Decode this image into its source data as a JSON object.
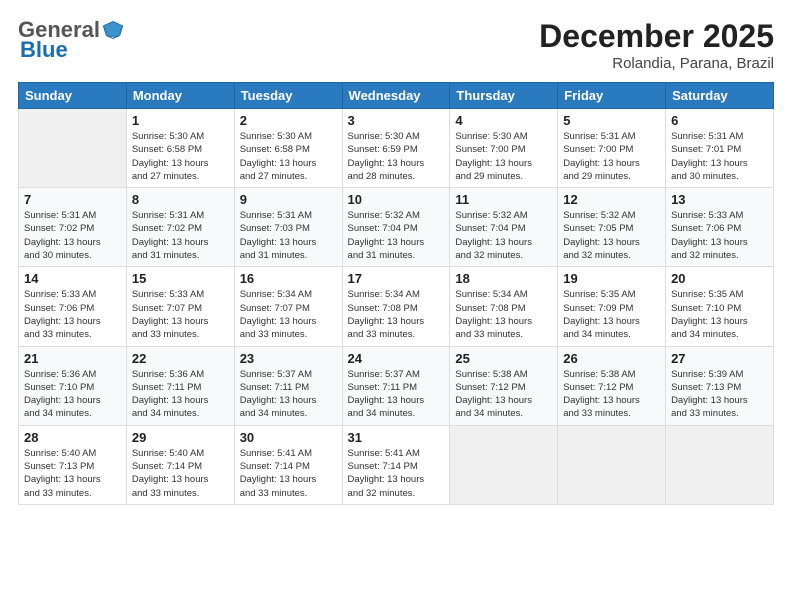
{
  "logo": {
    "general": "General",
    "blue": "Blue"
  },
  "header": {
    "month": "December 2025",
    "location": "Rolandia, Parana, Brazil"
  },
  "weekdays": [
    "Sunday",
    "Monday",
    "Tuesday",
    "Wednesday",
    "Thursday",
    "Friday",
    "Saturday"
  ],
  "weeks": [
    [
      {
        "day": "",
        "info": ""
      },
      {
        "day": "1",
        "info": "Sunrise: 5:30 AM\nSunset: 6:58 PM\nDaylight: 13 hours\nand 27 minutes."
      },
      {
        "day": "2",
        "info": "Sunrise: 5:30 AM\nSunset: 6:58 PM\nDaylight: 13 hours\nand 27 minutes."
      },
      {
        "day": "3",
        "info": "Sunrise: 5:30 AM\nSunset: 6:59 PM\nDaylight: 13 hours\nand 28 minutes."
      },
      {
        "day": "4",
        "info": "Sunrise: 5:30 AM\nSunset: 7:00 PM\nDaylight: 13 hours\nand 29 minutes."
      },
      {
        "day": "5",
        "info": "Sunrise: 5:31 AM\nSunset: 7:00 PM\nDaylight: 13 hours\nand 29 minutes."
      },
      {
        "day": "6",
        "info": "Sunrise: 5:31 AM\nSunset: 7:01 PM\nDaylight: 13 hours\nand 30 minutes."
      }
    ],
    [
      {
        "day": "7",
        "info": "Sunrise: 5:31 AM\nSunset: 7:02 PM\nDaylight: 13 hours\nand 30 minutes."
      },
      {
        "day": "8",
        "info": "Sunrise: 5:31 AM\nSunset: 7:02 PM\nDaylight: 13 hours\nand 31 minutes."
      },
      {
        "day": "9",
        "info": "Sunrise: 5:31 AM\nSunset: 7:03 PM\nDaylight: 13 hours\nand 31 minutes."
      },
      {
        "day": "10",
        "info": "Sunrise: 5:32 AM\nSunset: 7:04 PM\nDaylight: 13 hours\nand 31 minutes."
      },
      {
        "day": "11",
        "info": "Sunrise: 5:32 AM\nSunset: 7:04 PM\nDaylight: 13 hours\nand 32 minutes."
      },
      {
        "day": "12",
        "info": "Sunrise: 5:32 AM\nSunset: 7:05 PM\nDaylight: 13 hours\nand 32 minutes."
      },
      {
        "day": "13",
        "info": "Sunrise: 5:33 AM\nSunset: 7:06 PM\nDaylight: 13 hours\nand 32 minutes."
      }
    ],
    [
      {
        "day": "14",
        "info": "Sunrise: 5:33 AM\nSunset: 7:06 PM\nDaylight: 13 hours\nand 33 minutes."
      },
      {
        "day": "15",
        "info": "Sunrise: 5:33 AM\nSunset: 7:07 PM\nDaylight: 13 hours\nand 33 minutes."
      },
      {
        "day": "16",
        "info": "Sunrise: 5:34 AM\nSunset: 7:07 PM\nDaylight: 13 hours\nand 33 minutes."
      },
      {
        "day": "17",
        "info": "Sunrise: 5:34 AM\nSunset: 7:08 PM\nDaylight: 13 hours\nand 33 minutes."
      },
      {
        "day": "18",
        "info": "Sunrise: 5:34 AM\nSunset: 7:08 PM\nDaylight: 13 hours\nand 33 minutes."
      },
      {
        "day": "19",
        "info": "Sunrise: 5:35 AM\nSunset: 7:09 PM\nDaylight: 13 hours\nand 34 minutes."
      },
      {
        "day": "20",
        "info": "Sunrise: 5:35 AM\nSunset: 7:10 PM\nDaylight: 13 hours\nand 34 minutes."
      }
    ],
    [
      {
        "day": "21",
        "info": "Sunrise: 5:36 AM\nSunset: 7:10 PM\nDaylight: 13 hours\nand 34 minutes."
      },
      {
        "day": "22",
        "info": "Sunrise: 5:36 AM\nSunset: 7:11 PM\nDaylight: 13 hours\nand 34 minutes."
      },
      {
        "day": "23",
        "info": "Sunrise: 5:37 AM\nSunset: 7:11 PM\nDaylight: 13 hours\nand 34 minutes."
      },
      {
        "day": "24",
        "info": "Sunrise: 5:37 AM\nSunset: 7:11 PM\nDaylight: 13 hours\nand 34 minutes."
      },
      {
        "day": "25",
        "info": "Sunrise: 5:38 AM\nSunset: 7:12 PM\nDaylight: 13 hours\nand 34 minutes."
      },
      {
        "day": "26",
        "info": "Sunrise: 5:38 AM\nSunset: 7:12 PM\nDaylight: 13 hours\nand 33 minutes."
      },
      {
        "day": "27",
        "info": "Sunrise: 5:39 AM\nSunset: 7:13 PM\nDaylight: 13 hours\nand 33 minutes."
      }
    ],
    [
      {
        "day": "28",
        "info": "Sunrise: 5:40 AM\nSunset: 7:13 PM\nDaylight: 13 hours\nand 33 minutes."
      },
      {
        "day": "29",
        "info": "Sunrise: 5:40 AM\nSunset: 7:14 PM\nDaylight: 13 hours\nand 33 minutes."
      },
      {
        "day": "30",
        "info": "Sunrise: 5:41 AM\nSunset: 7:14 PM\nDaylight: 13 hours\nand 33 minutes."
      },
      {
        "day": "31",
        "info": "Sunrise: 5:41 AM\nSunset: 7:14 PM\nDaylight: 13 hours\nand 32 minutes."
      },
      {
        "day": "",
        "info": ""
      },
      {
        "day": "",
        "info": ""
      },
      {
        "day": "",
        "info": ""
      }
    ]
  ]
}
